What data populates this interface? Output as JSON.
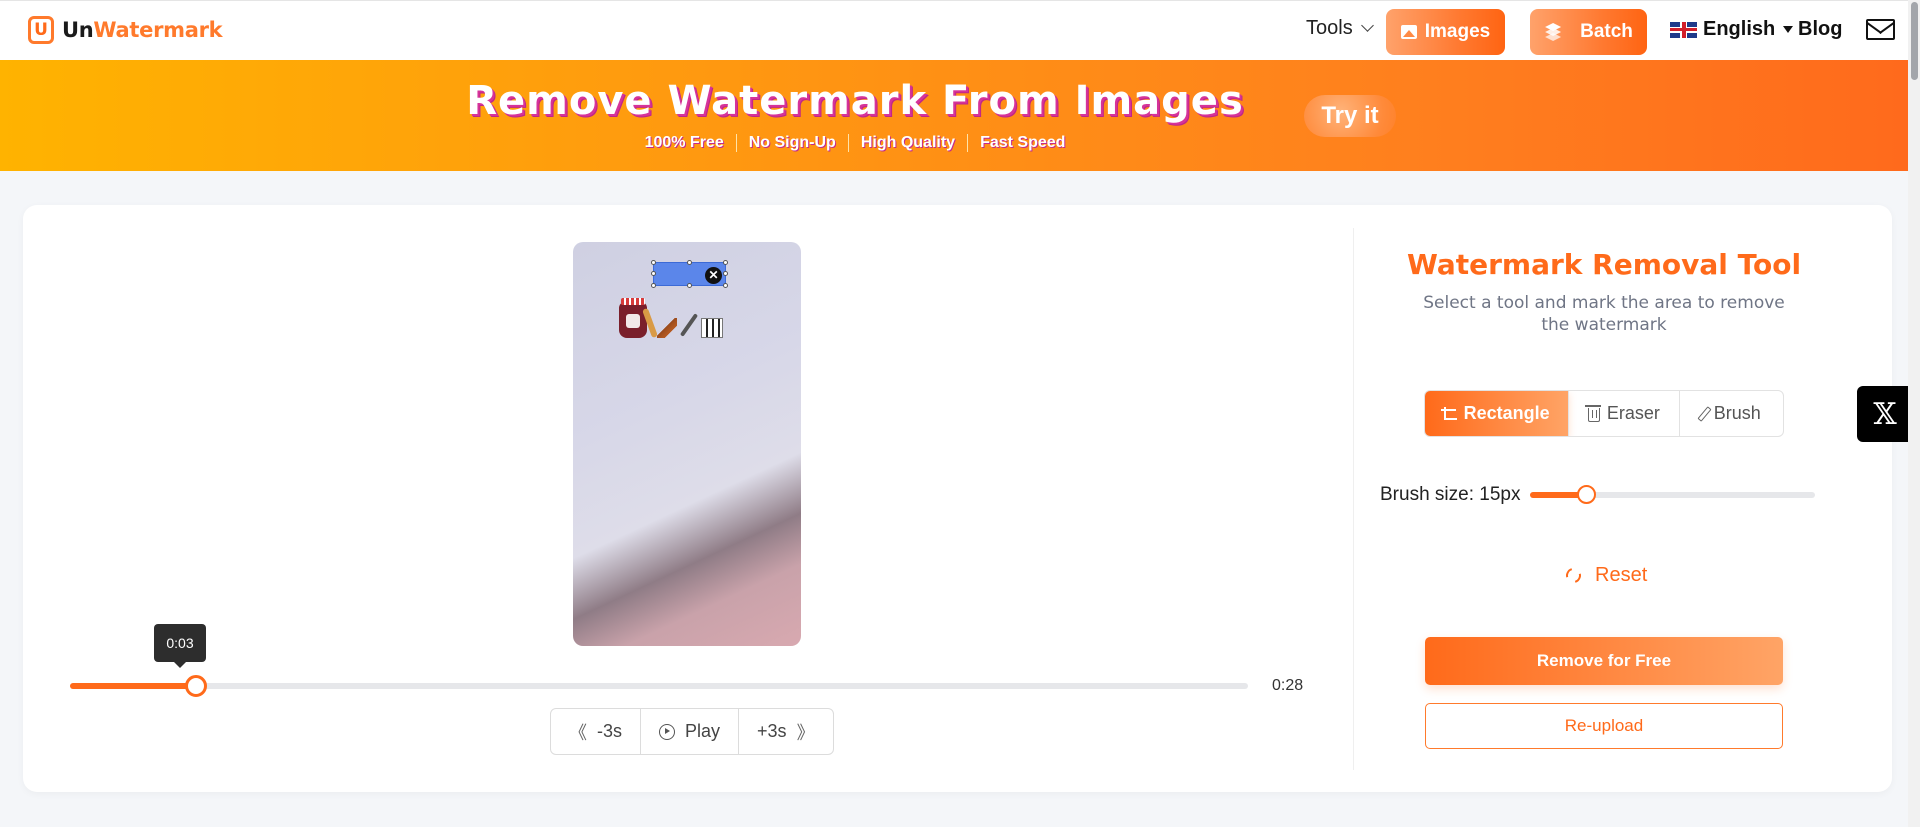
{
  "header": {
    "logo": {
      "prefix": "Un",
      "suffix": "Watermark",
      "mark": "U"
    },
    "nav": {
      "tools_label": "Tools",
      "images_label": "Images",
      "batch_label": "Batch",
      "language_label": "English",
      "blog_label": "Blog"
    },
    "icons": [
      "image-icon",
      "layers-icon",
      "uk-flag-icon",
      "caret-down-icon",
      "mail-icon"
    ]
  },
  "banner": {
    "title": "Remove Watermark From Images",
    "features": [
      "100% Free",
      "No Sign-Up",
      "High Quality",
      "Fast Speed"
    ],
    "cta_label": "Try it"
  },
  "player": {
    "selection_close_glyph": "✕",
    "current_time": "0:03",
    "duration": "0:28",
    "progress_fraction": 0.107,
    "controls": {
      "back_label": "-3s",
      "play_label": "Play",
      "forward_label": "+3s",
      "back_glyph": "《",
      "forward_glyph": "》"
    }
  },
  "tool_panel": {
    "title": "Watermark Removal Tool",
    "subtitle": "Select a tool and mark the area to remove the watermark",
    "tools": [
      {
        "label": "Rectangle",
        "icon": "crop-icon",
        "active": true
      },
      {
        "label": "Eraser",
        "icon": "trash-icon",
        "active": false
      },
      {
        "label": "Brush",
        "icon": "pen-icon",
        "active": false
      }
    ],
    "brush_size_label": "Brush size: 15px",
    "brush_size_value": 15,
    "brush_size_fraction": 0.2,
    "reset_label": "Reset",
    "remove_label": "Remove for Free",
    "reupload_label": "Re-upload"
  },
  "share": {
    "x_glyph": "𝕏"
  },
  "colors": {
    "accent": "#ff6a1a",
    "accent_light": "#ffa466",
    "banner_start": "#ffb300",
    "banner_end": "#ff6a1c",
    "title_shadow": "#d6339a"
  }
}
